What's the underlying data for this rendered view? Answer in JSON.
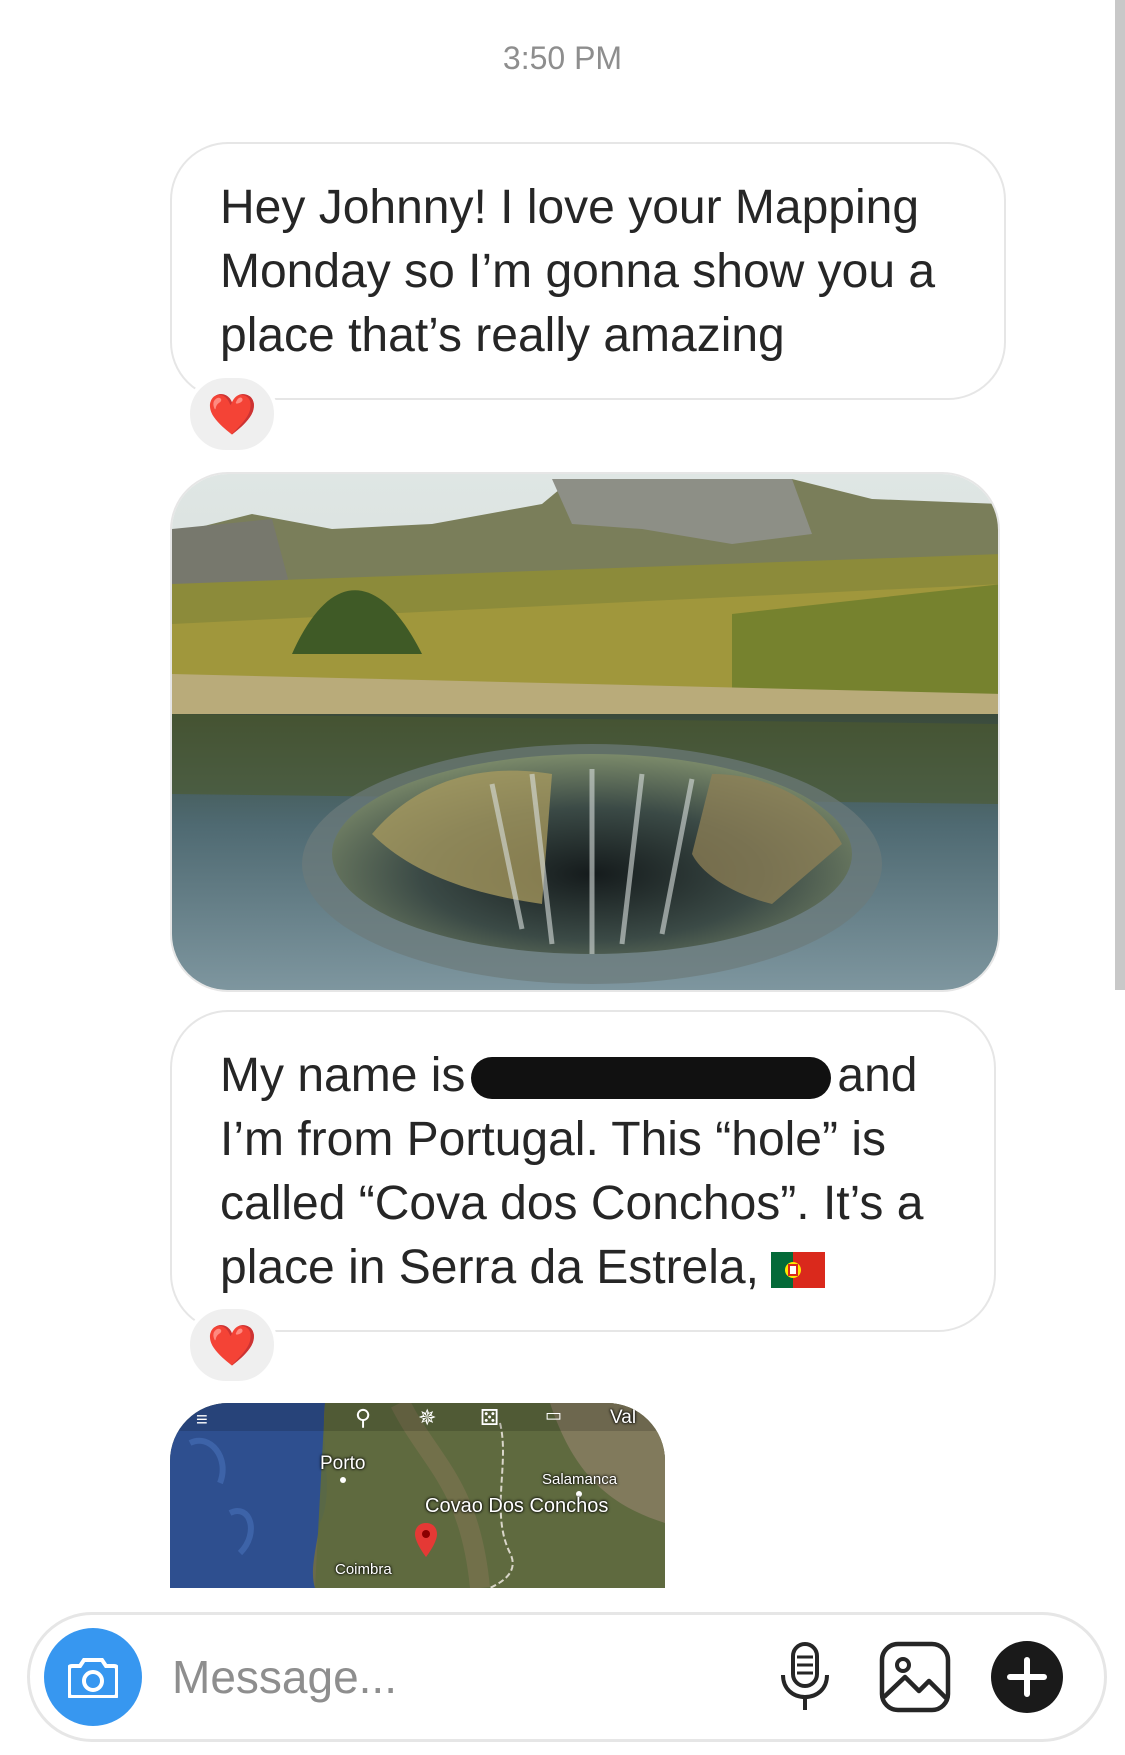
{
  "thread": {
    "timestamp": "3:50 PM"
  },
  "messages": [
    {
      "text": "Hey Johnny! I love your Mapping Monday so I’m gonna show you a place that’s really amazing",
      "reaction": "❤️"
    },
    {
      "type": "photo",
      "icon": "sinkhole-landscape-photo"
    },
    {
      "text_before": "My name is",
      "text_after": "and I’m from Portugal. This “hole” is called “Cova dos Conchos”. It’s a place in Serra da Estrela,",
      "emoji": "portugal-flag-icon",
      "reaction": "❤️"
    },
    {
      "type": "map",
      "labels": {
        "porto": "Porto",
        "salamanca": "Salamanca",
        "covao": "Covao Dos Conchos",
        "coimbra": "Coimbra",
        "valla": "Val"
      }
    }
  ],
  "composer": {
    "placeholder": "Message...",
    "value": ""
  },
  "colors": {
    "accent": "#3797f0",
    "bubble_border": "#e6e6e6",
    "timestamp": "#8e8e8e",
    "reaction_bg": "#efefef"
  }
}
